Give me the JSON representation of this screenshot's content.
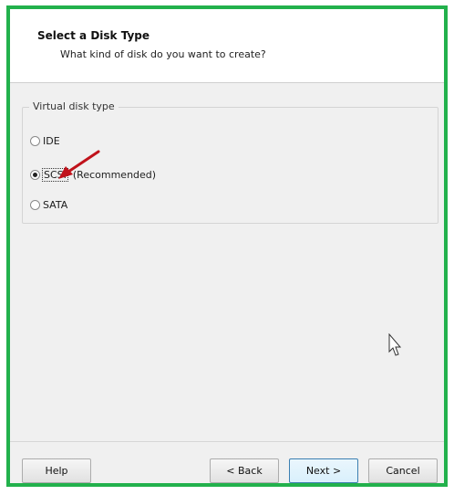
{
  "header": {
    "title": "Select a Disk Type",
    "subtitle": "What kind of disk do you want to create?"
  },
  "disk_type_group": {
    "legend": "Virtual disk type",
    "options": [
      {
        "label": "IDE",
        "checked": false
      },
      {
        "label": "SCSI",
        "note": "(Recommended)",
        "checked": true
      },
      {
        "label": "SATA",
        "checked": false
      }
    ]
  },
  "annotation": {
    "arrow_color": "#c0121b"
  },
  "highlight_border_color": "#22b14c",
  "footer": {
    "help_label": "Help",
    "back_label": "< Back",
    "next_label": "Next >",
    "cancel_label": "Cancel"
  }
}
